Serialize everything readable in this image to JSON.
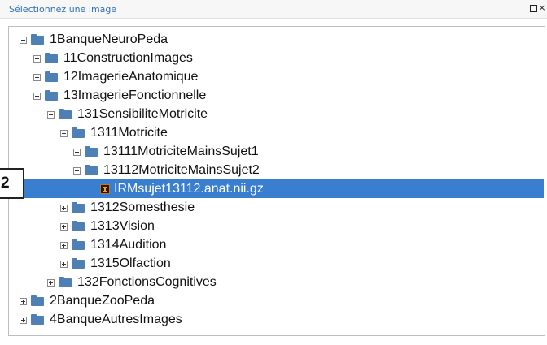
{
  "dialog": {
    "title": "Sélectionnez une image",
    "maximize_icon": "maximize-icon",
    "close_icon": "close-icon",
    "close_glyph": "×"
  },
  "callout": {
    "label": "2"
  },
  "colors": {
    "selection": "#3a7ed0",
    "folder": "#4e80b6",
    "title": "#2f73b5"
  },
  "tree": [
    {
      "label": "1BanqueNeuroPeda",
      "expanded": true
    },
    {
      "label": "11ConstructionImages",
      "expanded": false
    },
    {
      "label": "12ImagerieAnatomique",
      "expanded": false
    },
    {
      "label": "13ImagerieFonctionnelle",
      "expanded": true
    },
    {
      "label": "131SensibiliteMotricite",
      "expanded": true
    },
    {
      "label": "1311Motricite",
      "expanded": true
    },
    {
      "label": "13111MotriciteMainsSujet1",
      "expanded": false
    },
    {
      "label": "13112MotriciteMainsSujet2",
      "expanded": true
    },
    {
      "label": "IRMsujet13112.anat.nii.gz",
      "type": "file",
      "selected": true
    },
    {
      "label": "1312Somesthesie",
      "expanded": false
    },
    {
      "label": "1313Vision",
      "expanded": false
    },
    {
      "label": "1314Audition",
      "expanded": false
    },
    {
      "label": "1315Olfaction",
      "expanded": false
    },
    {
      "label": "132FonctionsCognitives",
      "expanded": false
    },
    {
      "label": "2BanqueZooPeda",
      "expanded": false
    },
    {
      "label": "4BanqueAutresImages",
      "expanded": false
    }
  ]
}
